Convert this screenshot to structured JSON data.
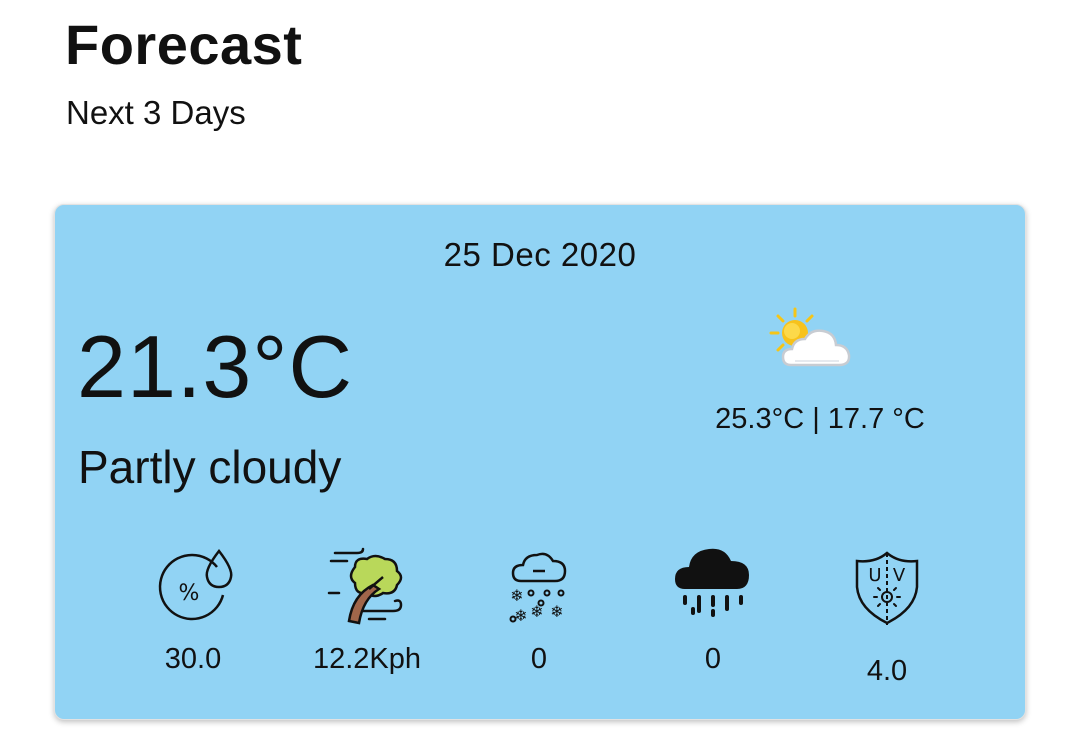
{
  "header": {
    "title": "Forecast",
    "subtitle": "Next 3 Days"
  },
  "card": {
    "date": "25 Dec 2020",
    "current_temp": "21.3°C",
    "condition": "Partly cloudy",
    "condition_icon": "partly-cloudy-icon",
    "temp_range": "25.3°C | 17.7 °C",
    "background_color": "#91d3f4",
    "stats": [
      {
        "icon": "humidity-icon",
        "value": "30.0"
      },
      {
        "icon": "wind-icon",
        "value": "12.2Kph"
      },
      {
        "icon": "snow-icon",
        "value": "0"
      },
      {
        "icon": "rain-icon",
        "value": "0"
      },
      {
        "icon": "uv-index-icon",
        "value": "4.0"
      }
    ]
  }
}
